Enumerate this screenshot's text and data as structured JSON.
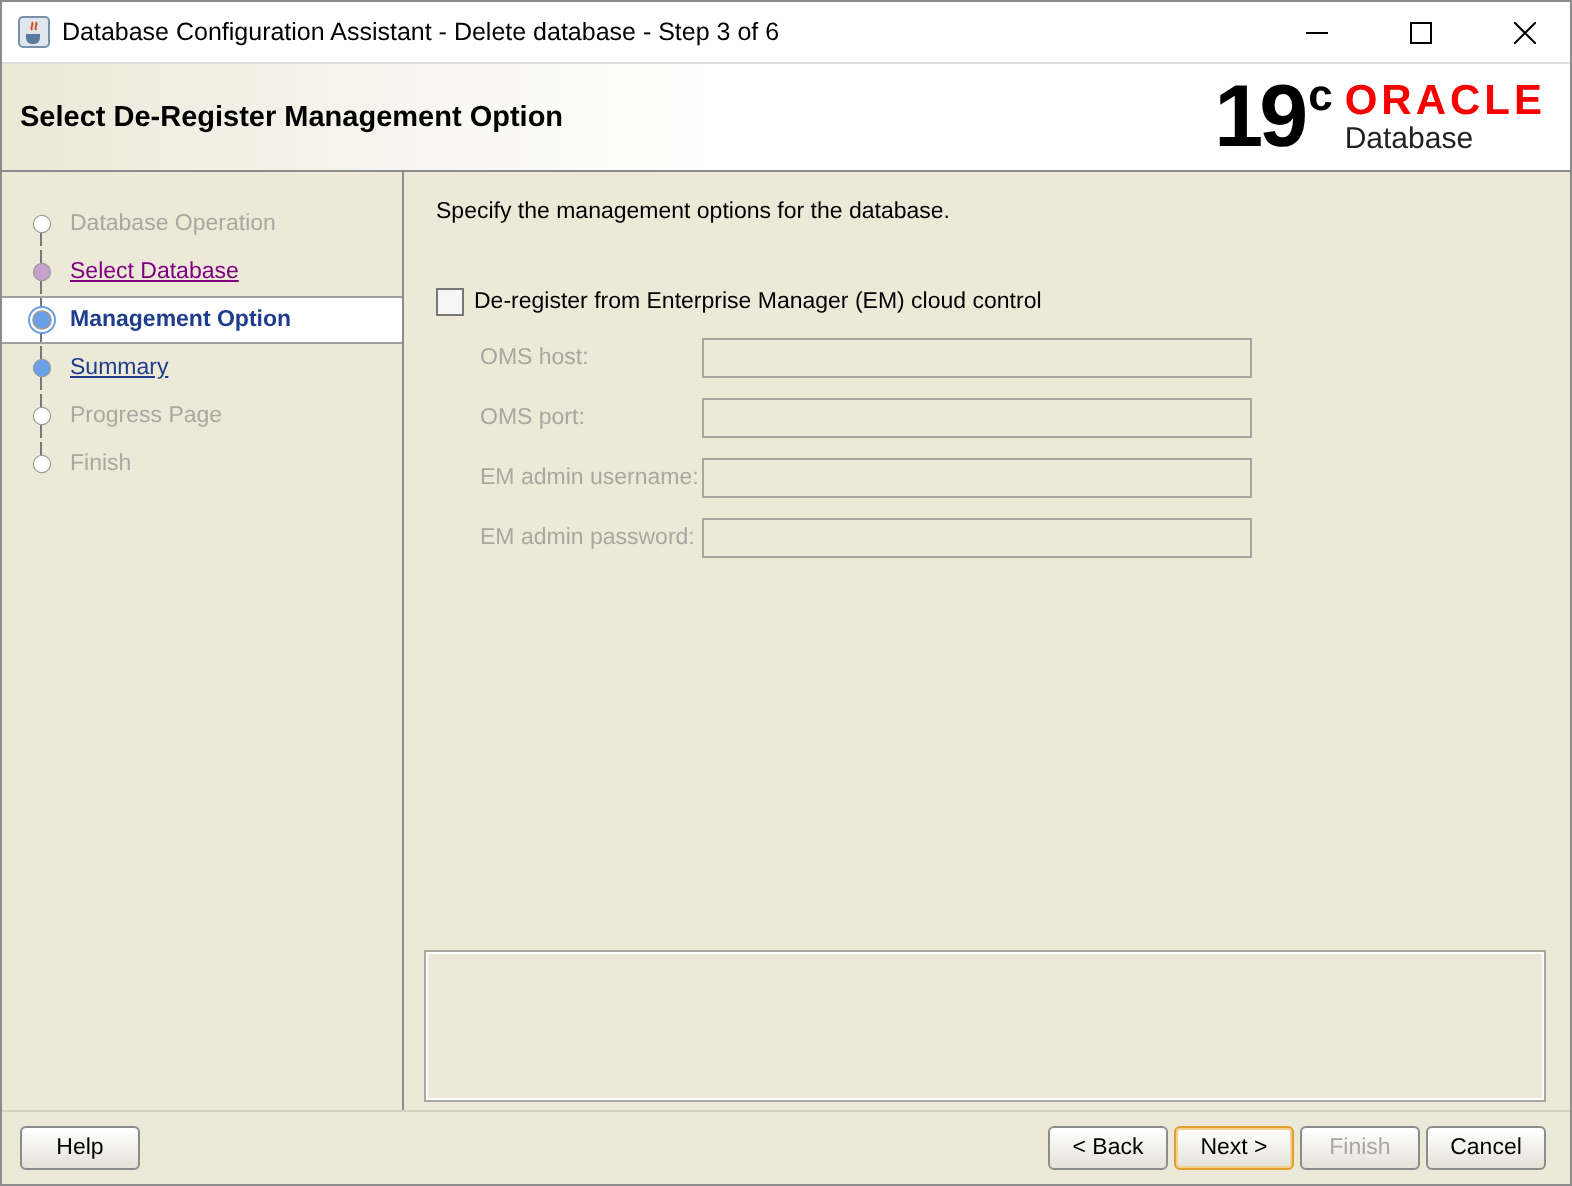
{
  "window": {
    "title": "Database Configuration Assistant - Delete database - Step 3 of 6"
  },
  "header": {
    "title": "Select De-Register Management Option",
    "logo": {
      "version": "19",
      "superscript": "c",
      "brand": "ORACLE",
      "product": "Database"
    }
  },
  "steps": [
    {
      "label": "Database Operation",
      "kind": "disabled",
      "selected": false
    },
    {
      "label": "Select Database",
      "kind": "visited",
      "selected": false
    },
    {
      "label": "Management Option",
      "kind": "current",
      "selected": true
    },
    {
      "label": "Summary",
      "kind": "link",
      "selected": false
    },
    {
      "label": "Progress Page",
      "kind": "disabled",
      "selected": false
    },
    {
      "label": "Finish",
      "kind": "disabled",
      "selected": false
    }
  ],
  "content": {
    "instruction": "Specify the management options for the database.",
    "checkbox": {
      "label": "De-register from Enterprise Manager (EM) cloud control",
      "checked": false
    },
    "fields": [
      {
        "label": "OMS host:",
        "disabled": true
      },
      {
        "label": "OMS port:",
        "disabled": true
      },
      {
        "label": "EM admin username:",
        "disabled": true
      },
      {
        "label": "EM admin password:",
        "disabled": true
      }
    ]
  },
  "buttons": {
    "left": [
      {
        "label": "Help",
        "disabled": false,
        "focused": false
      }
    ],
    "right": [
      {
        "label": "< Back",
        "disabled": false,
        "focused": false
      },
      {
        "label": "Next >",
        "disabled": false,
        "focused": true
      },
      {
        "label": "Finish",
        "disabled": true,
        "focused": false
      },
      {
        "label": "Cancel",
        "disabled": false,
        "focused": false
      }
    ]
  }
}
